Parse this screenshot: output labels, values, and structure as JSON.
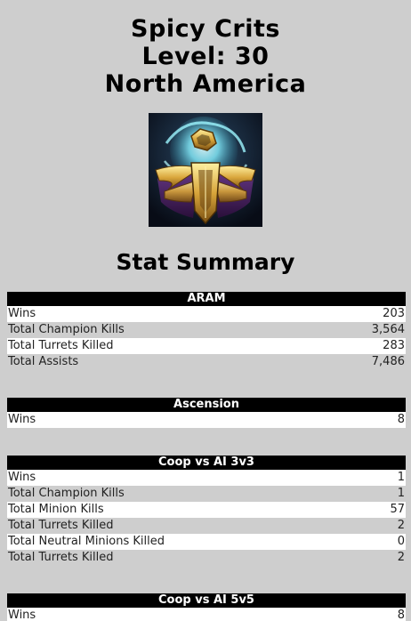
{
  "profile": {
    "name": "Spicy Crits",
    "level": "Level: 30",
    "region": "North America"
  },
  "summary_title": "Stat Summary",
  "sections": [
    {
      "title": "ARAM",
      "rows": [
        {
          "label": "Wins",
          "value": "203"
        },
        {
          "label": "Total Champion Kills",
          "value": "3,564"
        },
        {
          "label": "Total Turrets Killed",
          "value": "283"
        },
        {
          "label": "Total Assists",
          "value": "7,486"
        }
      ]
    },
    {
      "title": "Ascension",
      "rows": [
        {
          "label": "Wins",
          "value": "8"
        }
      ]
    },
    {
      "title": "Coop vs AI 3v3",
      "rows": [
        {
          "label": "Wins",
          "value": "1"
        },
        {
          "label": "Total Champion Kills",
          "value": "1"
        },
        {
          "label": "Total Minion Kills",
          "value": "57"
        },
        {
          "label": "Total Turrets Killed",
          "value": "2"
        },
        {
          "label": "Total Neutral Minions Killed",
          "value": "0"
        },
        {
          "label": "Total Turrets Killed",
          "value": "2"
        }
      ]
    },
    {
      "title": "Coop vs AI 5v5",
      "rows": [
        {
          "label": "Wins",
          "value": "8"
        }
      ]
    }
  ]
}
